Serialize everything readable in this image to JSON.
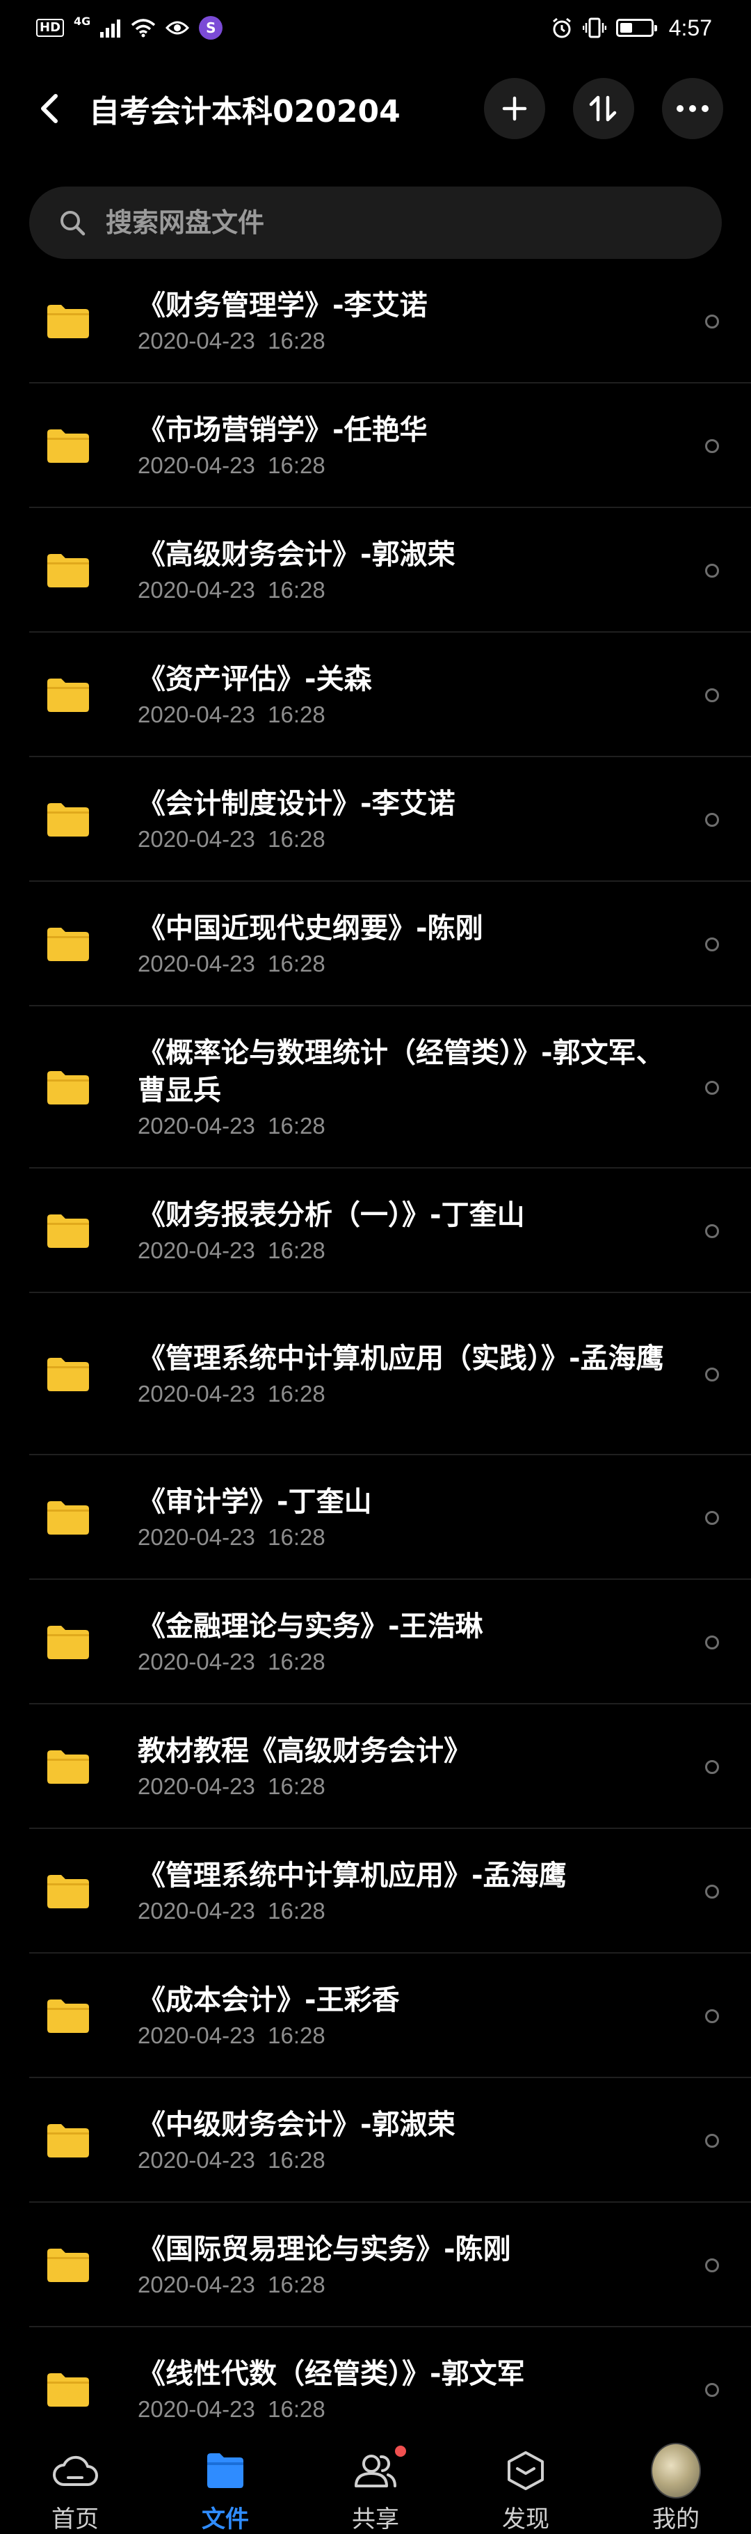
{
  "status_bar": {
    "hd": "HD",
    "network": "4G",
    "app_badge": "S",
    "battery_level": 0.4,
    "time": "4:57"
  },
  "header": {
    "title": "自考会计本科020204"
  },
  "search": {
    "placeholder": "搜索网盘文件"
  },
  "files": [
    {
      "name": "《财务管理学》-李艾诺",
      "date": "2020-04-23  16:28"
    },
    {
      "name": "《市场营销学》-任艳华",
      "date": "2020-04-23  16:28"
    },
    {
      "name": "《高级财务会计》-郭淑荣",
      "date": "2020-04-23  16:28"
    },
    {
      "name": "《资产评估》-关森",
      "date": "2020-04-23  16:28"
    },
    {
      "name": "《会计制度设计》-李艾诺",
      "date": "2020-04-23  16:28"
    },
    {
      "name": "《中国近现代史纲要》-陈刚",
      "date": "2020-04-23  16:28"
    },
    {
      "name": "《概率论与数理统计（经管类）》-郭文军、曹显兵",
      "date": "2020-04-23  16:28"
    },
    {
      "name": "《财务报表分析（一）》-丁奎山",
      "date": "2020-04-23  16:28"
    },
    {
      "name": "《管理系统中计算机应用（实践）》-孟海鹰",
      "date": "2020-04-23  16:28"
    },
    {
      "name": "《审计学》-丁奎山",
      "date": "2020-04-23  16:28"
    },
    {
      "name": "《金融理论与实务》-王浩琳",
      "date": "2020-04-23  16:28"
    },
    {
      "name": "教材教程《高级财务会计》",
      "date": "2020-04-23  16:28"
    },
    {
      "name": "《管理系统中计算机应用》-孟海鹰",
      "date": "2020-04-23  16:28"
    },
    {
      "name": "《成本会计》-王彩香",
      "date": "2020-04-23  16:28"
    },
    {
      "name": "《中级财务会计》-郭淑荣",
      "date": "2020-04-23  16:28"
    },
    {
      "name": "《国际贸易理论与实务》-陈刚",
      "date": "2020-04-23  16:28"
    },
    {
      "name": "《线性代数（经管类）》-郭文军",
      "date": "2020-04-23  16:28"
    }
  ],
  "bottom_nav": {
    "items": [
      {
        "label": "首页",
        "icon": "cloud-home-icon"
      },
      {
        "label": "文件",
        "icon": "folder-icon"
      },
      {
        "label": "共享",
        "icon": "people-icon"
      },
      {
        "label": "发现",
        "icon": "cube-icon"
      },
      {
        "label": "我的",
        "icon": "avatar"
      }
    ]
  },
  "colors": {
    "background": "#000000",
    "folder": "#F6C531",
    "active": "#2F8CFF",
    "badge": "#F05050"
  }
}
